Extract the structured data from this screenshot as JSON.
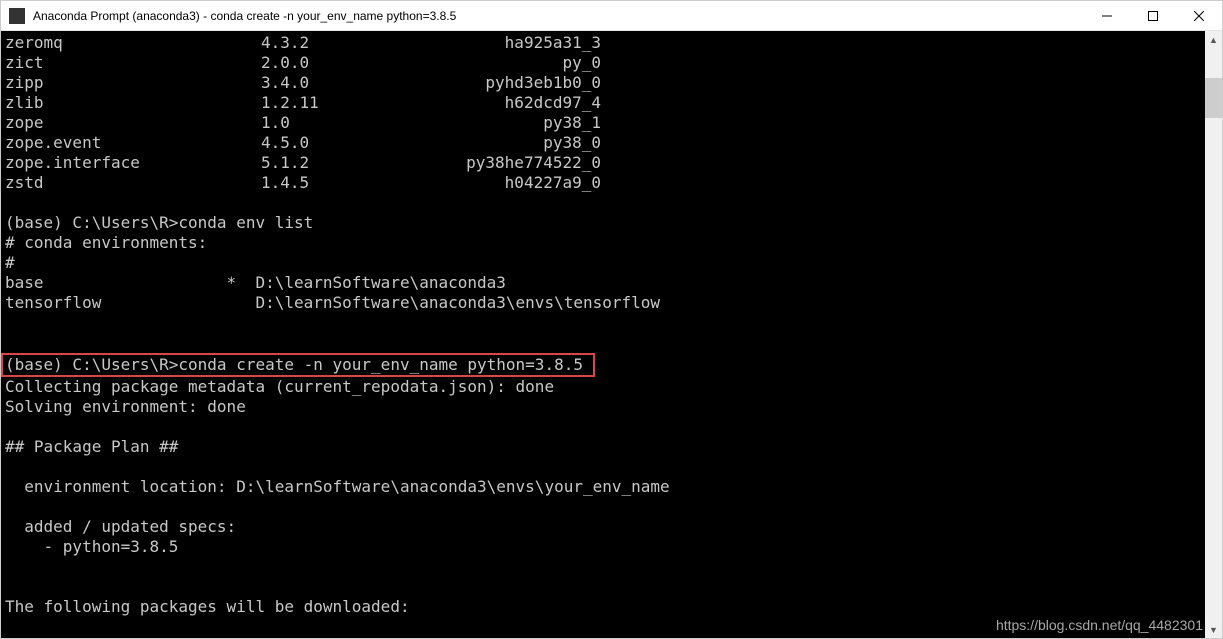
{
  "titlebar": {
    "title": "Anaconda Prompt (anaconda3) - conda  create -n your_env_name python=3.8.5"
  },
  "packages": [
    {
      "name": "zeromq",
      "ver": "4.3.2",
      "build": "ha925a31_3"
    },
    {
      "name": "zict",
      "ver": "2.0.0",
      "build": "py_0"
    },
    {
      "name": "zipp",
      "ver": "3.4.0",
      "build": "pyhd3eb1b0_0"
    },
    {
      "name": "zlib",
      "ver": "1.2.11",
      "build": "h62dcd97_4"
    },
    {
      "name": "zope",
      "ver": "1.0",
      "build": "py38_1"
    },
    {
      "name": "zope.event",
      "ver": "4.5.0",
      "build": "py38_0"
    },
    {
      "name": "zope.interface",
      "ver": "5.1.2",
      "build": "py38he774522_0"
    },
    {
      "name": "zstd",
      "ver": "1.4.5",
      "build": "h04227a9_0"
    }
  ],
  "envlist": {
    "prompt": "(base) C:\\Users\\R>",
    "cmd": "conda env list",
    "header": "# conda environments:",
    "hash": "#",
    "rows": [
      {
        "name": "base",
        "mark": "*",
        "path": "D:\\learnSoftware\\anaconda3"
      },
      {
        "name": "tensorflow",
        "mark": " ",
        "path": "D:\\learnSoftware\\anaconda3\\envs\\tensorflow"
      }
    ]
  },
  "create": {
    "prompt": "(base) C:\\Users\\R>",
    "cmd": "conda create -n your_env_name python=3.8.5",
    "collecting": "Collecting package metadata (current_repodata.json): done",
    "solving": "Solving environment: done",
    "plan_header": "## Package Plan ##",
    "loc": "  environment location: D:\\learnSoftware\\anaconda3\\envs\\your_env_name",
    "added_header": "  added / updated specs:",
    "added_item": "    - python=3.8.5",
    "download_header": "The following packages will be downloaded:"
  },
  "watermark": "https://blog.csdn.net/qq_4482301"
}
